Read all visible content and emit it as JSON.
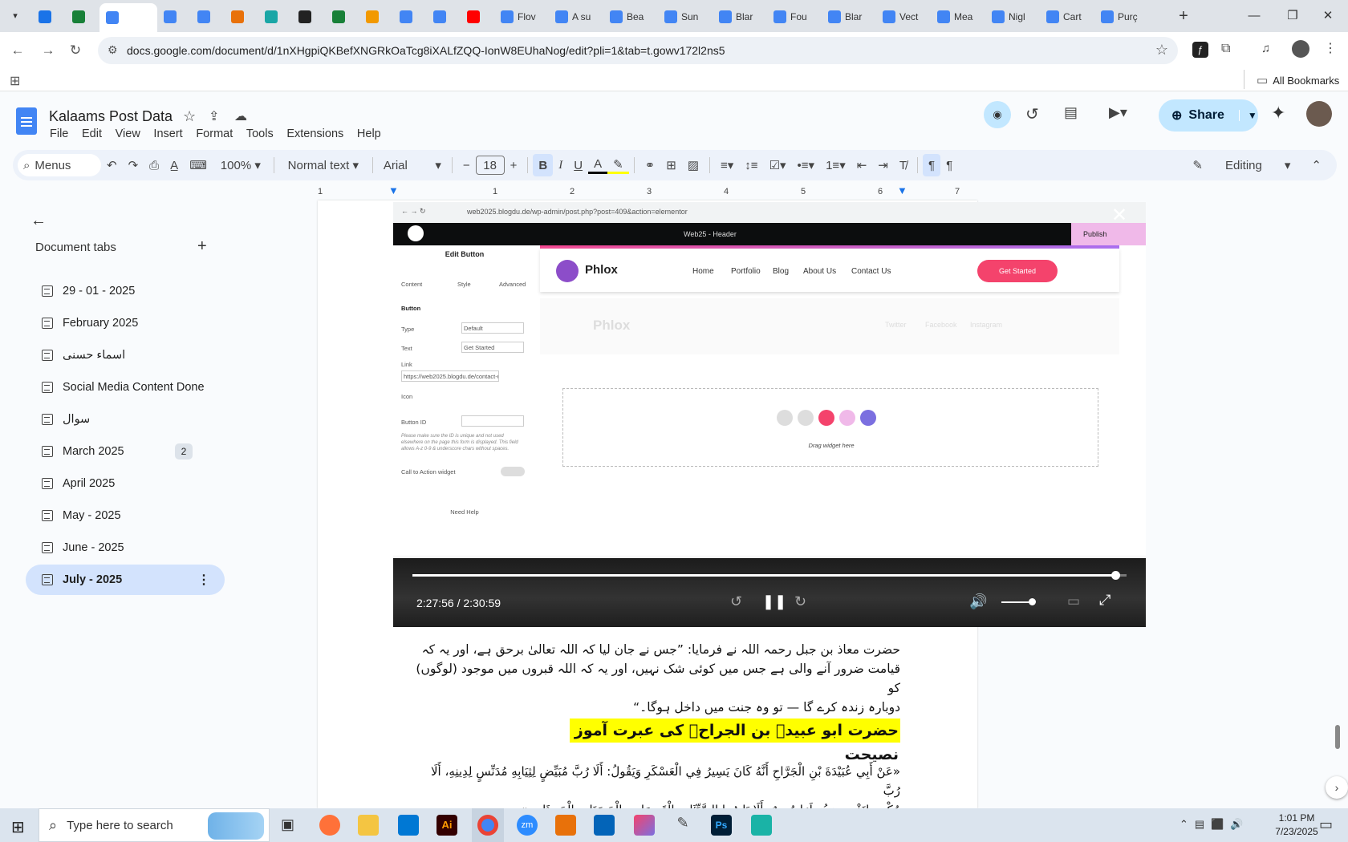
{
  "browser": {
    "tabs": [
      {
        "title": "",
        "color": "#1a73e8"
      },
      {
        "title": "",
        "color": "#188038"
      },
      {
        "title": "",
        "color": "#4285f4",
        "active": true
      },
      {
        "title": "",
        "color": "#4285f4"
      },
      {
        "title": "",
        "color": "#4285f4"
      },
      {
        "title": "",
        "color": "#e8710a"
      },
      {
        "title": "",
        "color": "#1aa6a6"
      },
      {
        "title": "",
        "color": "#222"
      },
      {
        "title": "",
        "color": "#188038"
      },
      {
        "title": "",
        "color": "#f29900"
      },
      {
        "title": "",
        "color": "#4285f4"
      },
      {
        "title": "",
        "color": "#4285f4"
      },
      {
        "title": "",
        "color": "#ff0000"
      },
      {
        "title": "Flov",
        "color": "#4285f4"
      },
      {
        "title": "A su",
        "color": "#4285f4"
      },
      {
        "title": "Bea",
        "color": "#4285f4"
      },
      {
        "title": "Sun",
        "color": "#4285f4"
      },
      {
        "title": "Blar",
        "color": "#4285f4"
      },
      {
        "title": "Fou",
        "color": "#4285f4"
      },
      {
        "title": "Blar",
        "color": "#4285f4"
      },
      {
        "title": "Vect",
        "color": "#4285f4"
      },
      {
        "title": "Mea",
        "color": "#4285f4"
      },
      {
        "title": "Nigl",
        "color": "#4285f4"
      },
      {
        "title": "Cart",
        "color": "#4285f4"
      },
      {
        "title": "Purç",
        "color": "#4285f4"
      }
    ],
    "url": "docs.google.com/document/d/1nXHgpiQKBefXNGRkOaTcg8iXALfZQQ-IonW8EUhaNog/edit?pli=1&tab=t.gowv172l2ns5",
    "bookmarks_label": "All Bookmarks"
  },
  "doc": {
    "title": "Kalaams Post Data",
    "menu": [
      "File",
      "Edit",
      "View",
      "Insert",
      "Format",
      "Tools",
      "Extensions",
      "Help"
    ],
    "share_label": "Share",
    "toolbar": {
      "menus_label": "Menus",
      "zoom": "100%",
      "style": "Normal text",
      "font": "Arial",
      "font_size": "18",
      "mode": "Editing"
    },
    "ruler": [
      "1",
      "1",
      "2",
      "3",
      "4",
      "5",
      "6",
      "7"
    ]
  },
  "sidebar": {
    "heading": "Document tabs",
    "tabs": [
      {
        "label": "29 - 01 - 2025"
      },
      {
        "label": "February 2025"
      },
      {
        "label": "اسماء حسنی"
      },
      {
        "label": "Social Media Content Done"
      },
      {
        "label": "سوال"
      },
      {
        "label": "March 2025",
        "badge": "2"
      },
      {
        "label": "April 2025"
      },
      {
        "label": "May - 2025"
      },
      {
        "label": "June - 2025"
      },
      {
        "label": "July - 2025",
        "selected": true
      }
    ]
  },
  "video": {
    "inner_url": "web2025.blogdu.de/wp-admin/post.php?post=409&action=elementor",
    "elementor": {
      "header_select": "Web25 - Header",
      "publish": "Publish",
      "panel_title": "Edit Button",
      "panel_tabs": [
        "Content",
        "Style",
        "Advanced"
      ],
      "section": "Button",
      "type_label": "Type",
      "type_value": "Default",
      "text_label": "Text",
      "text_value": "Get Started",
      "link_label": "Link",
      "link_value": "https://web2025.blogdu.de/contact-u",
      "icon_label": "Icon",
      "button_id_label": "Button ID",
      "help_text": "Please make sure the ID is unique and not used elsewhere on the page this form is displayed. This field allows A-z 0-9 & underscore chars without spaces.",
      "cta_label": "Call to Action widget",
      "need_help": "Need Help"
    },
    "site": {
      "logo": "Phlox",
      "nav": [
        "Home",
        "Portfolio",
        "Blog",
        "About Us",
        "Contact Us"
      ],
      "cta": "Get Started",
      "footer_links": [
        "Twitter",
        "Facebook",
        "Instagram"
      ],
      "drag_text": "Drag widget here"
    },
    "time": "2:27:56 / 2:30:59",
    "progress": 0.984
  },
  "content": {
    "para1_line1": "حضرت معاذ بن جبل رحمہ اللہ نے فرمایا: ”جس نے جان لیا کہ اللہ تعالیٰ برحق ہے، اور یہ کہ",
    "para1_line2": "قیامت ضرور آنے والی ہے جس میں کوئی شک نہیں، اور یہ کہ اللہ قبروں میں موجود (لوگوں) کو",
    "para1_line3": "دوبارہ زندہ کرے گا — تو وہ جنت میں داخل ہوگا۔“",
    "heading": "حضرت ابو عبیدہ بن الجراحؓ کی عبرت آموز نصیحت",
    "arabic_line1": "«عَنْ أَبِي عُبَيْدَةَ بْنِ الْجَرَّاحِ أَنَّهُ كَانَ يَسِيرُ فِي الْعَسْكَرِ وَيَقُولُ: أَلَا رُبَّ مُبَيِّضٍ لِثِيَابِهِ مُدَنِّسٍ لِدِينِهِ، أَلَا رُبَّ",
    "arabic_line2": "مُكْرِمٍ لِنَفْسِهِ وَهُوَ لَهَا مُهِينٌ، أَلَا بَادِرُوا السَّيِّئَاتِ الْقَدِيمَاتِ بِالْحَسَنَاتِ الْحَدِيثَاتِ.»"
  },
  "taskbar": {
    "search_placeholder": "Type here to search",
    "time": "1:01 PM",
    "date": "7/23/2025"
  }
}
